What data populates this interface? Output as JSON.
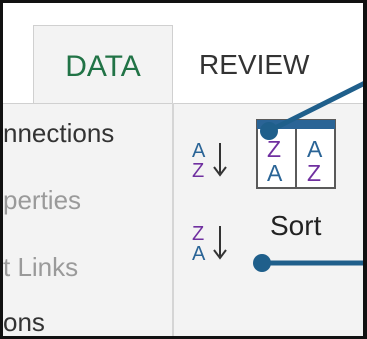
{
  "tabs": [
    {
      "label": "DATA"
    },
    {
      "label": "REVIEW"
    }
  ],
  "connections_group": {
    "items": [
      {
        "label": "nnections"
      },
      {
        "label": "perties"
      },
      {
        "label": "t Links"
      },
      {
        "label": "ons"
      }
    ]
  },
  "sort_group": {
    "sort_az_icon": "sort-a-to-z-icon",
    "sort_za_icon": "sort-z-to-a-icon",
    "sort_dialog_icon": "sort-dialog-icon",
    "sort_label": "Sort",
    "sort_dialog_letters": [
      "Z",
      "A",
      "A",
      "Z"
    ]
  },
  "colors": {
    "data_tab_text": "#217346",
    "accent_blue": "#2a6496",
    "icon_purple": "#7030a0",
    "callout": "#1f5f8b"
  }
}
